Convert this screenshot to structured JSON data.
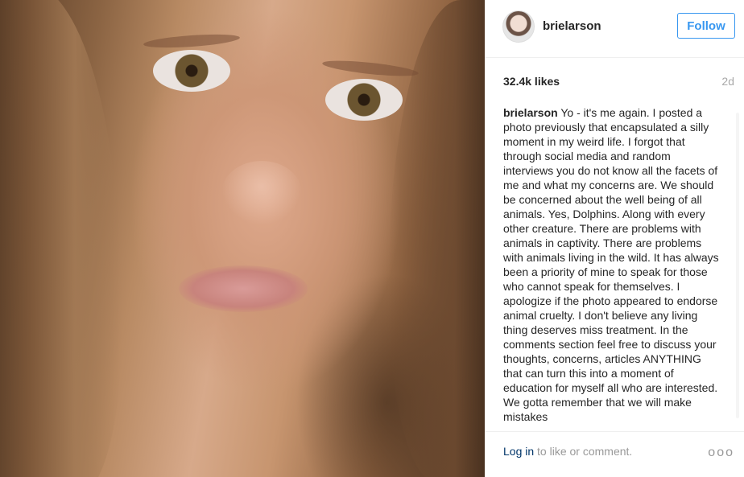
{
  "post": {
    "username": "brielarson",
    "follow_label": "Follow",
    "likes": "32.4k likes",
    "age": "2d",
    "caption_user": "brielarson",
    "caption_text": "Yo - it's me again. I posted a photo previously that encapsulated a silly moment in my weird life. I forgot that through social media and random interviews you do not know all the facets of me and what my concerns are. We should be concerned about the well being of all animals. Yes, Dolphins. Along with every other creature. There are problems with animals in captivity. There are problems with animals living in the wild. It has always been a priority of mine to speak for those who cannot speak for themselves. I apologize if the photo appeared to endorse animal cruelty. I don't believe any living thing deserves miss treatment. In the comments section feel free to discuss your thoughts, concerns, articles ANYTHING that can turn this into a moment of education for myself all who are interested. We gotta remember that we will make mistakes",
    "login_link": "Log in",
    "login_suffix": " to like or comment.",
    "more_icon": "ooo"
  },
  "colors": {
    "accent": "#3897f0",
    "link": "#003569",
    "muted": "#999999"
  },
  "icons": {
    "more": "ellipsis-icon",
    "avatar": "profile-avatar"
  }
}
